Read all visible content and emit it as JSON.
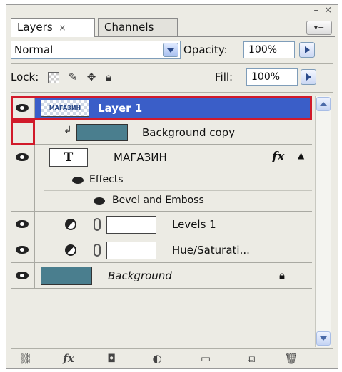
{
  "panel": {
    "tabs": [
      {
        "label": "Layers",
        "close": "×"
      },
      {
        "label": "Channels"
      }
    ],
    "window_controls": "– ×",
    "menu_icon": "▾≡"
  },
  "blend": {
    "mode": "Normal",
    "opacity_label": "Opacity:",
    "opacity_value": "100%"
  },
  "lock": {
    "label": "Lock:",
    "fill_label": "Fill:",
    "fill_value": "100%"
  },
  "layers": [
    {
      "name": "Layer 1",
      "thumb_text": "МАГАЗИН",
      "selected": true
    },
    {
      "name": "Background copy",
      "clipped": true
    },
    {
      "name": "МАГАЗИН",
      "type": "text",
      "fx": "fx",
      "type_glyph": "T"
    },
    {
      "name": "Effects"
    },
    {
      "name": "Bevel and Emboss"
    },
    {
      "name": "Levels 1"
    },
    {
      "name": "Hue/Saturati..."
    },
    {
      "name": "Background",
      "locked": true
    }
  ],
  "colors": {
    "selected": "#3a5ec8",
    "highlight_box": "#d11a2a",
    "swatch": "#4a7e8e"
  },
  "bottom_icons": [
    "link-icon",
    "fx-icon",
    "mask-icon",
    "adjustment-icon",
    "folder-icon",
    "new-layer-icon",
    "trash-icon"
  ]
}
